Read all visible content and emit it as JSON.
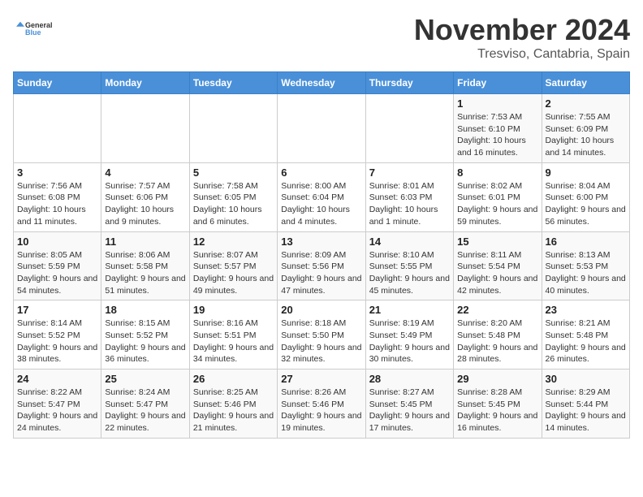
{
  "logo": {
    "text_general": "General",
    "text_blue": "Blue"
  },
  "title": {
    "month": "November 2024",
    "location": "Tresviso, Cantabria, Spain"
  },
  "days_of_week": [
    "Sunday",
    "Monday",
    "Tuesday",
    "Wednesday",
    "Thursday",
    "Friday",
    "Saturday"
  ],
  "weeks": [
    [
      {
        "day": "",
        "info": ""
      },
      {
        "day": "",
        "info": ""
      },
      {
        "day": "",
        "info": ""
      },
      {
        "day": "",
        "info": ""
      },
      {
        "day": "",
        "info": ""
      },
      {
        "day": "1",
        "info": "Sunrise: 7:53 AM\nSunset: 6:10 PM\nDaylight: 10 hours and 16 minutes."
      },
      {
        "day": "2",
        "info": "Sunrise: 7:55 AM\nSunset: 6:09 PM\nDaylight: 10 hours and 14 minutes."
      }
    ],
    [
      {
        "day": "3",
        "info": "Sunrise: 7:56 AM\nSunset: 6:08 PM\nDaylight: 10 hours and 11 minutes."
      },
      {
        "day": "4",
        "info": "Sunrise: 7:57 AM\nSunset: 6:06 PM\nDaylight: 10 hours and 9 minutes."
      },
      {
        "day": "5",
        "info": "Sunrise: 7:58 AM\nSunset: 6:05 PM\nDaylight: 10 hours and 6 minutes."
      },
      {
        "day": "6",
        "info": "Sunrise: 8:00 AM\nSunset: 6:04 PM\nDaylight: 10 hours and 4 minutes."
      },
      {
        "day": "7",
        "info": "Sunrise: 8:01 AM\nSunset: 6:03 PM\nDaylight: 10 hours and 1 minute."
      },
      {
        "day": "8",
        "info": "Sunrise: 8:02 AM\nSunset: 6:01 PM\nDaylight: 9 hours and 59 minutes."
      },
      {
        "day": "9",
        "info": "Sunrise: 8:04 AM\nSunset: 6:00 PM\nDaylight: 9 hours and 56 minutes."
      }
    ],
    [
      {
        "day": "10",
        "info": "Sunrise: 8:05 AM\nSunset: 5:59 PM\nDaylight: 9 hours and 54 minutes."
      },
      {
        "day": "11",
        "info": "Sunrise: 8:06 AM\nSunset: 5:58 PM\nDaylight: 9 hours and 51 minutes."
      },
      {
        "day": "12",
        "info": "Sunrise: 8:07 AM\nSunset: 5:57 PM\nDaylight: 9 hours and 49 minutes."
      },
      {
        "day": "13",
        "info": "Sunrise: 8:09 AM\nSunset: 5:56 PM\nDaylight: 9 hours and 47 minutes."
      },
      {
        "day": "14",
        "info": "Sunrise: 8:10 AM\nSunset: 5:55 PM\nDaylight: 9 hours and 45 minutes."
      },
      {
        "day": "15",
        "info": "Sunrise: 8:11 AM\nSunset: 5:54 PM\nDaylight: 9 hours and 42 minutes."
      },
      {
        "day": "16",
        "info": "Sunrise: 8:13 AM\nSunset: 5:53 PM\nDaylight: 9 hours and 40 minutes."
      }
    ],
    [
      {
        "day": "17",
        "info": "Sunrise: 8:14 AM\nSunset: 5:52 PM\nDaylight: 9 hours and 38 minutes."
      },
      {
        "day": "18",
        "info": "Sunrise: 8:15 AM\nSunset: 5:52 PM\nDaylight: 9 hours and 36 minutes."
      },
      {
        "day": "19",
        "info": "Sunrise: 8:16 AM\nSunset: 5:51 PM\nDaylight: 9 hours and 34 minutes."
      },
      {
        "day": "20",
        "info": "Sunrise: 8:18 AM\nSunset: 5:50 PM\nDaylight: 9 hours and 32 minutes."
      },
      {
        "day": "21",
        "info": "Sunrise: 8:19 AM\nSunset: 5:49 PM\nDaylight: 9 hours and 30 minutes."
      },
      {
        "day": "22",
        "info": "Sunrise: 8:20 AM\nSunset: 5:48 PM\nDaylight: 9 hours and 28 minutes."
      },
      {
        "day": "23",
        "info": "Sunrise: 8:21 AM\nSunset: 5:48 PM\nDaylight: 9 hours and 26 minutes."
      }
    ],
    [
      {
        "day": "24",
        "info": "Sunrise: 8:22 AM\nSunset: 5:47 PM\nDaylight: 9 hours and 24 minutes."
      },
      {
        "day": "25",
        "info": "Sunrise: 8:24 AM\nSunset: 5:47 PM\nDaylight: 9 hours and 22 minutes."
      },
      {
        "day": "26",
        "info": "Sunrise: 8:25 AM\nSunset: 5:46 PM\nDaylight: 9 hours and 21 minutes."
      },
      {
        "day": "27",
        "info": "Sunrise: 8:26 AM\nSunset: 5:46 PM\nDaylight: 9 hours and 19 minutes."
      },
      {
        "day": "28",
        "info": "Sunrise: 8:27 AM\nSunset: 5:45 PM\nDaylight: 9 hours and 17 minutes."
      },
      {
        "day": "29",
        "info": "Sunrise: 8:28 AM\nSunset: 5:45 PM\nDaylight: 9 hours and 16 minutes."
      },
      {
        "day": "30",
        "info": "Sunrise: 8:29 AM\nSunset: 5:44 PM\nDaylight: 9 hours and 14 minutes."
      }
    ]
  ]
}
